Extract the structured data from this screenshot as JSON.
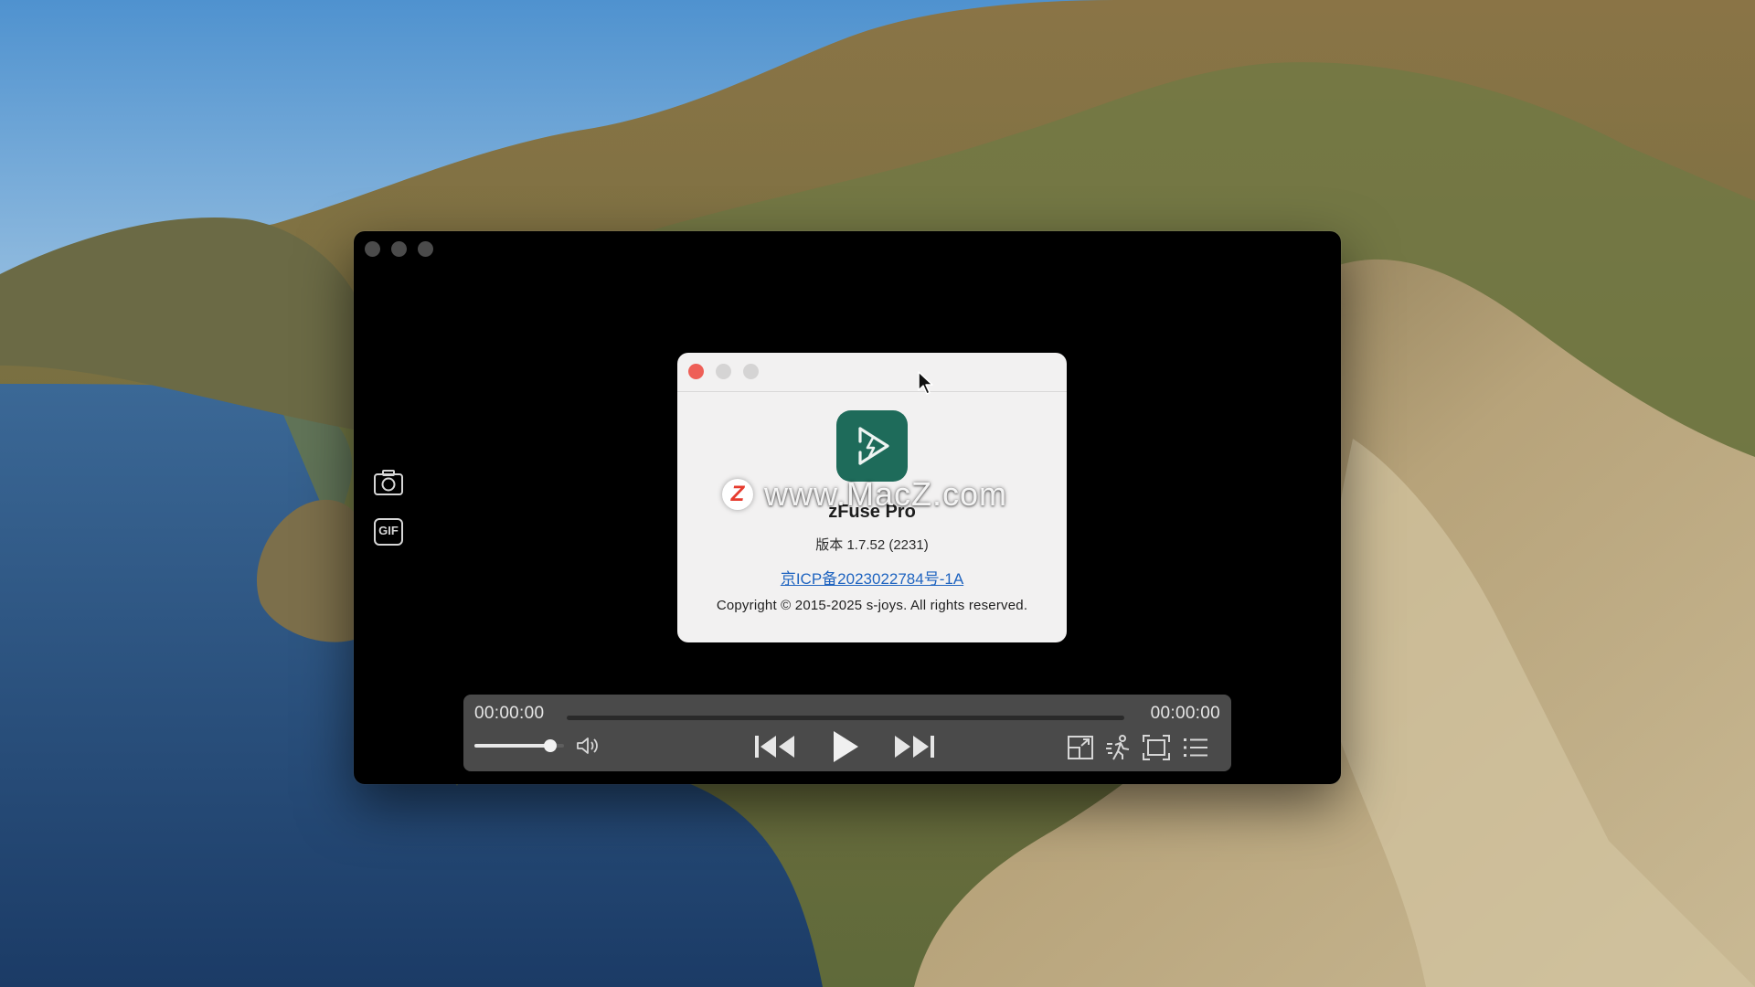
{
  "desktop": {
    "wallpaper": "coastal-island-landscape"
  },
  "player": {
    "window_buttons": [
      "close",
      "minimize",
      "zoom"
    ],
    "side_tools": [
      {
        "name": "screenshot",
        "icon": "camera-icon"
      },
      {
        "name": "gif",
        "icon": "gif-icon",
        "label": "GIF"
      }
    ],
    "controls": {
      "current_time": "00:00:00",
      "total_time": "00:00:00",
      "progress": 0,
      "volume": 0.85,
      "buttons": [
        "skip-back",
        "play",
        "skip-forward",
        "picture-in-picture",
        "playback-speed",
        "fullscreen",
        "playlist"
      ]
    }
  },
  "about": {
    "app_name": "zFuse Pro",
    "version": "版本 1.7.52 (2231)",
    "icp_link": "京ICP备2023022784号-1A",
    "copyright": "Copyright © 2015-2025 s-joys. All rights reserved.",
    "icon_color": "#1e6b5a"
  },
  "watermark": {
    "logo_letter": "Z",
    "text": "www.MacZ.com"
  },
  "colors": {
    "close_red": "#ee5f57",
    "link_blue": "#1f64c0",
    "control_bar": "#4a4a4a"
  }
}
